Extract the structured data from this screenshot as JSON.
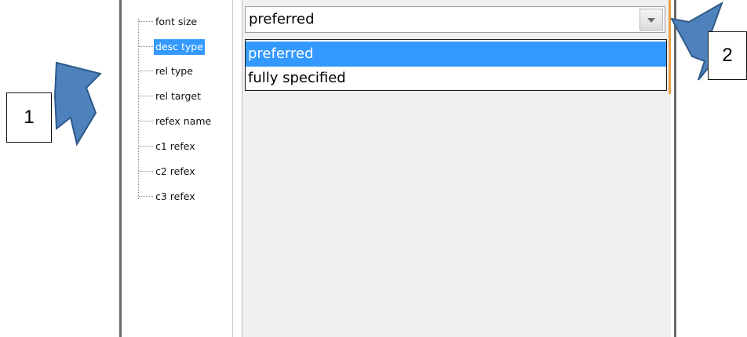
{
  "tree": {
    "items": [
      {
        "label": "font size",
        "selected": false
      },
      {
        "label": "desc type",
        "selected": true
      },
      {
        "label": "rel type",
        "selected": false
      },
      {
        "label": "rel target",
        "selected": false
      },
      {
        "label": "refex name",
        "selected": false
      },
      {
        "label": "c1 refex",
        "selected": false
      },
      {
        "label": "c2 refex",
        "selected": false
      },
      {
        "label": "c3 refex",
        "selected": false
      }
    ]
  },
  "combo": {
    "value": "preferred",
    "icon": "chevron-down-icon"
  },
  "dropdown": {
    "options": [
      {
        "label": "preferred",
        "highlighted": true
      },
      {
        "label": "fully specified",
        "highlighted": false
      }
    ]
  },
  "callouts": [
    {
      "label": "1",
      "icon": "arrow-icon"
    },
    {
      "label": "2",
      "icon": "arrow-icon"
    }
  ],
  "colors": {
    "selection": "#3399ff",
    "arrow_fill": "#4f81bd",
    "arrow_stroke": "#2e5a88",
    "accent_edge": "#e8a04a"
  }
}
